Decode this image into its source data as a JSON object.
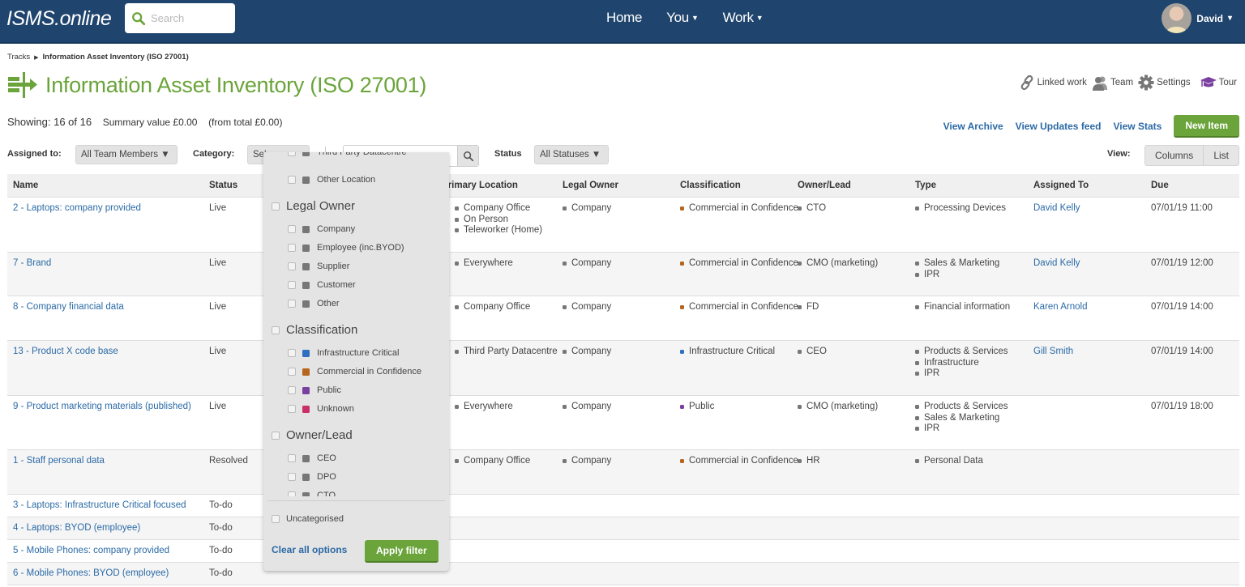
{
  "app": {
    "logo": "ISMS.online",
    "search_placeholder": "Search",
    "nav": [
      {
        "label": "Home",
        "caret": false
      },
      {
        "label": "You",
        "caret": true
      },
      {
        "label": "Work",
        "caret": true
      }
    ],
    "user": {
      "name": "David",
      "caret": "▾"
    }
  },
  "breadcrumb": {
    "root": "Tracks",
    "current": "Information Asset Inventory (ISO 27001)"
  },
  "page": {
    "title": "Information Asset Inventory (ISO 27001)",
    "tools": [
      {
        "icon": "link-icon",
        "label": "Linked work"
      },
      {
        "icon": "team-icon",
        "label": "Team"
      },
      {
        "icon": "gear-icon",
        "label": "Settings"
      },
      {
        "icon": "graduation-cap-icon",
        "label": "Tour"
      }
    ],
    "showing": "Showing: 16 of 16",
    "summary": "Summary value £0.00",
    "total": "(from total £0.00)",
    "links": [
      "View Archive",
      "View Updates feed",
      "View Stats"
    ],
    "new_item": "New Item"
  },
  "filters": {
    "assigned_label": "Assigned to:",
    "assigned_value": "All Team Members ▼",
    "category_label": "Category:",
    "category_value": "Se' ",
    "search_placeholder": "",
    "status_label": "Status",
    "status_value": "All Statuses ▼",
    "view_label": "View:",
    "view_options": [
      "Columns",
      "List"
    ]
  },
  "colors": {
    "brand_nav": "#1f446d",
    "accent_green": "#6aa43a",
    "link_blue": "#2b6aa6",
    "infrastructure_critical": "#2f6fbf",
    "commercial_in_confidence": "#b5651d",
    "public": "#7b3fa0",
    "unknown": "#c9306a",
    "neutral": "#777777"
  },
  "table": {
    "headers": [
      "Name",
      "Status",
      "",
      "Primary Location",
      "Legal Owner",
      "Classification",
      "Owner/Lead",
      "Type",
      "Assigned To",
      "Due"
    ],
    "rows": [
      {
        "name": "2 - Laptops: company provided",
        "status": "Live",
        "location": [
          "Company Office",
          "On Person",
          "Teleworker (Home)"
        ],
        "legal_owner": [
          "Company"
        ],
        "classification": [
          {
            "label": "Commercial in Confidence",
            "color": "#b5651d"
          }
        ],
        "owner": [
          "CTO"
        ],
        "type": [
          "Processing Devices"
        ],
        "assigned": "David Kelly",
        "due": "07/01/19 11:00"
      },
      {
        "name": "7 - Brand",
        "status": "Live",
        "location": [
          "Everywhere"
        ],
        "legal_owner": [
          "Company"
        ],
        "classification": [
          {
            "label": "Commercial in Confidence",
            "color": "#b5651d"
          }
        ],
        "owner": [
          "CMO (marketing)"
        ],
        "type": [
          "Sales & Marketing",
          "IPR"
        ],
        "assigned": "David Kelly",
        "due": "07/01/19 12:00"
      },
      {
        "name": "8 - Company financial data",
        "status": "Live",
        "location": [
          "Company Office"
        ],
        "legal_owner": [
          "Company"
        ],
        "classification": [
          {
            "label": "Commercial in Confidence",
            "color": "#b5651d"
          }
        ],
        "owner": [
          "FD"
        ],
        "type": [
          "Financial information"
        ],
        "assigned": "Karen Arnold",
        "due": "07/01/19 14:00"
      },
      {
        "name": "13 - Product X code base",
        "status": "Live",
        "location": [
          "Third Party Datacentre"
        ],
        "legal_owner": [
          "Company"
        ],
        "classification": [
          {
            "label": "Infrastructure Critical",
            "color": "#2f6fbf"
          }
        ],
        "owner": [
          "CEO"
        ],
        "type": [
          "Products & Services",
          "Infrastructure",
          "IPR"
        ],
        "assigned": "Gill Smith",
        "due": "07/01/19 14:00"
      },
      {
        "name": "9 - Product marketing materials (published)",
        "status": "Live",
        "location": [
          "Everywhere"
        ],
        "legal_owner": [
          "Company"
        ],
        "classification": [
          {
            "label": "Public",
            "color": "#7b3fa0"
          }
        ],
        "owner": [
          "CMO (marketing)"
        ],
        "type": [
          "Products & Services",
          "Sales & Marketing",
          "IPR"
        ],
        "assigned": "",
        "due": "07/01/19 18:00"
      },
      {
        "name": "1 - Staff personal data",
        "status": "Resolved",
        "location": [
          "Company Office"
        ],
        "legal_owner": [
          "Company"
        ],
        "classification": [
          {
            "label": "Commercial in Confidence",
            "color": "#b5651d"
          }
        ],
        "owner": [
          "HR"
        ],
        "type": [
          "Personal Data"
        ],
        "assigned": "",
        "due": ""
      },
      {
        "name": "3 - Laptops: Infrastructure Critical focused",
        "status": "To-do",
        "location": [],
        "legal_owner": [],
        "classification": [],
        "owner": [],
        "type": [],
        "assigned": "",
        "due": ""
      },
      {
        "name": "4 - Laptops: BYOD (employee)",
        "status": "To-do",
        "location": [],
        "legal_owner": [],
        "classification": [],
        "owner": [],
        "type": [],
        "assigned": "",
        "due": ""
      },
      {
        "name": "5 - Mobile Phones: company provided",
        "status": "To-do",
        "location": [],
        "legal_owner": [],
        "classification": [],
        "owner": [],
        "type": [],
        "assigned": "",
        "due": ""
      },
      {
        "name": "6 - Mobile Phones: BYOD (employee)",
        "status": "To-do",
        "location": [],
        "legal_owner": [],
        "classification": [],
        "owner": [],
        "type": [],
        "assigned": "",
        "due": ""
      }
    ]
  },
  "category_dropdown": {
    "items": [
      {
        "kind": "item",
        "label": "Third Party Datacentre",
        "color": "#777777"
      },
      {
        "kind": "item",
        "label": "Other Location",
        "color": "#777777"
      },
      {
        "kind": "group",
        "label": "Legal Owner"
      },
      {
        "kind": "item",
        "label": "Company",
        "color": "#777777"
      },
      {
        "kind": "item",
        "label": "Employee (inc.BYOD)",
        "color": "#777777"
      },
      {
        "kind": "item",
        "label": "Supplier",
        "color": "#777777"
      },
      {
        "kind": "item",
        "label": "Customer",
        "color": "#777777"
      },
      {
        "kind": "item",
        "label": "Other",
        "color": "#777777"
      },
      {
        "kind": "group",
        "label": "Classification"
      },
      {
        "kind": "item",
        "label": "Infrastructure Critical",
        "color": "#2f6fbf"
      },
      {
        "kind": "item",
        "label": "Commercial in Confidence",
        "color": "#b5651d"
      },
      {
        "kind": "item",
        "label": "Public",
        "color": "#7b3fa0"
      },
      {
        "kind": "item",
        "label": "Unknown",
        "color": "#c9306a"
      },
      {
        "kind": "group",
        "label": "Owner/Lead"
      },
      {
        "kind": "item",
        "label": "CEO",
        "color": "#777777"
      },
      {
        "kind": "item",
        "label": "DPO",
        "color": "#777777"
      },
      {
        "kind": "item",
        "label": "CTO",
        "color": "#777777"
      }
    ],
    "uncategorised": "Uncategorised",
    "clear_label": "Clear all options",
    "apply_label": "Apply filter"
  }
}
